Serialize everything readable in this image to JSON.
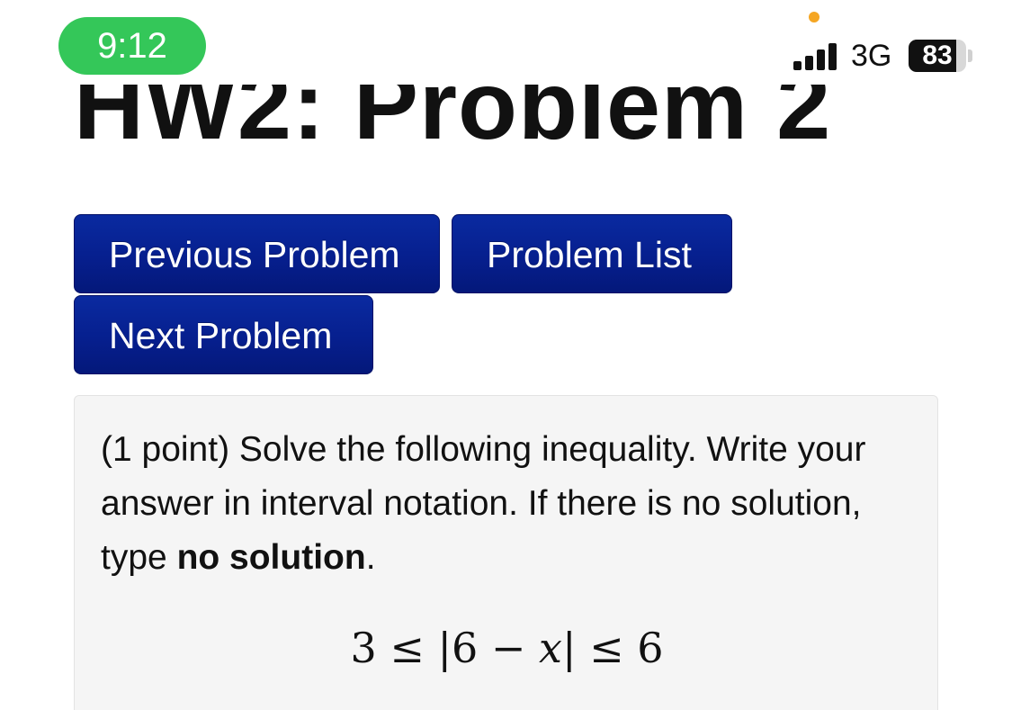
{
  "status_bar": {
    "time": "9:12",
    "network": "3G",
    "battery_level": "83",
    "battery_fraction": 0.83,
    "accent_time_pill": "#34c759",
    "privacy_dot_color": "#f5a623"
  },
  "page": {
    "title": "HW2: Problem 2"
  },
  "nav": {
    "previous_label": "Previous Problem",
    "list_label": "Problem List",
    "next_label": "Next Problem",
    "button_color": "#061f8e"
  },
  "problem": {
    "points": "(1 point)",
    "instructions": " Solve the following inequality. Write your answer in interval notation. If there is no solution, type ",
    "emphasis": "no solution",
    "end": ".",
    "equation_left": "3 ≤ |6 − ",
    "equation_var": "x",
    "equation_right": "| ≤ 6"
  }
}
